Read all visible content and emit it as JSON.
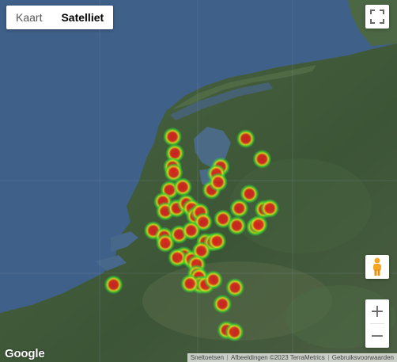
{
  "map_type": {
    "kaart": "Kaart",
    "satelliet": "Satelliet",
    "active": "Satelliet"
  },
  "controls": {
    "zoom_in": "+",
    "zoom_out": "−"
  },
  "logo": "Google",
  "attribution": {
    "shortcuts": "Sneltoetsen",
    "imagery": "Afbeeldingen ©2023 TerraMetrics",
    "terms": "Gebruiksvoorwaarden"
  },
  "colors": {
    "sea": "#41628a",
    "land": "#3f5a3a",
    "heat_low": "#2fd02f",
    "heat_mid": "#e3e01c",
    "heat_high": "#d11f1f"
  },
  "heatmap_points": [
    {
      "lon": 4.62,
      "lat": 53.15
    },
    {
      "lon": 4.66,
      "lat": 52.98
    },
    {
      "lon": 4.62,
      "lat": 52.84
    },
    {
      "lon": 4.64,
      "lat": 52.78
    },
    {
      "lon": 4.57,
      "lat": 52.6
    },
    {
      "lon": 4.79,
      "lat": 52.63
    },
    {
      "lon": 4.46,
      "lat": 52.48
    },
    {
      "lon": 4.5,
      "lat": 52.38
    },
    {
      "lon": 4.69,
      "lat": 52.41
    },
    {
      "lon": 4.85,
      "lat": 52.46
    },
    {
      "lon": 4.94,
      "lat": 52.41
    },
    {
      "lon": 5.0,
      "lat": 52.33
    },
    {
      "lon": 5.08,
      "lat": 52.37
    },
    {
      "lon": 5.13,
      "lat": 52.27
    },
    {
      "lon": 5.27,
      "lat": 52.6
    },
    {
      "lon": 5.42,
      "lat": 52.84
    },
    {
      "lon": 5.35,
      "lat": 52.77
    },
    {
      "lon": 5.38,
      "lat": 52.68
    },
    {
      "lon": 5.84,
      "lat": 53.13
    },
    {
      "lon": 6.11,
      "lat": 52.92
    },
    {
      "lon": 5.9,
      "lat": 52.56
    },
    {
      "lon": 6.14,
      "lat": 52.4
    },
    {
      "lon": 6.24,
      "lat": 52.41
    },
    {
      "lon": 5.73,
      "lat": 52.41
    },
    {
      "lon": 5.46,
      "lat": 52.3
    },
    {
      "lon": 5.69,
      "lat": 52.23
    },
    {
      "lon": 6.0,
      "lat": 52.22
    },
    {
      "lon": 6.05,
      "lat": 52.24
    },
    {
      "lon": 4.3,
      "lat": 52.18
    },
    {
      "lon": 4.48,
      "lat": 52.12
    },
    {
      "lon": 4.5,
      "lat": 52.05
    },
    {
      "lon": 4.73,
      "lat": 52.14
    },
    {
      "lon": 4.93,
      "lat": 52.18
    },
    {
      "lon": 5.17,
      "lat": 52.06
    },
    {
      "lon": 5.29,
      "lat": 52.06
    },
    {
      "lon": 5.36,
      "lat": 52.07
    },
    {
      "lon": 4.81,
      "lat": 51.92
    },
    {
      "lon": 4.7,
      "lat": 51.9
    },
    {
      "lon": 4.94,
      "lat": 51.88
    },
    {
      "lon": 5.1,
      "lat": 51.97
    },
    {
      "lon": 5.02,
      "lat": 51.83
    },
    {
      "lon": 5.02,
      "lat": 51.73
    },
    {
      "lon": 5.06,
      "lat": 51.7
    },
    {
      "lon": 5.08,
      "lat": 51.62
    },
    {
      "lon": 5.17,
      "lat": 51.62
    },
    {
      "lon": 5.3,
      "lat": 51.67
    },
    {
      "lon": 4.91,
      "lat": 51.63
    },
    {
      "lon": 3.64,
      "lat": 51.62
    },
    {
      "lon": 5.66,
      "lat": 51.59
    },
    {
      "lon": 5.45,
      "lat": 51.42
    },
    {
      "lon": 5.52,
      "lat": 51.15
    },
    {
      "lon": 5.65,
      "lat": 51.13
    }
  ]
}
